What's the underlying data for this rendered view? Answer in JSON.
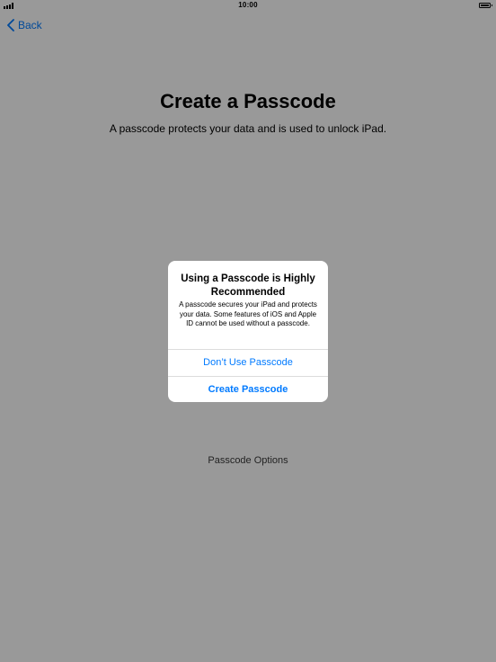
{
  "status_bar": {
    "time": "10:00"
  },
  "nav": {
    "back_label": "Back"
  },
  "page": {
    "title": "Create a Passcode",
    "subtitle": "A passcode protects your data and is used to unlock iPad.",
    "passcode_options_label": "Passcode Options"
  },
  "alert": {
    "title": "Using a Passcode is Highly Recommended",
    "message": "A passcode secures your iPad and protects your data. Some features of iOS and Apple ID cannot be used without a passcode.",
    "dont_use_label": "Don’t Use Passcode",
    "create_label": "Create Passcode"
  },
  "colors": {
    "accent": "#007aff",
    "overlay": "rgba(0,0,0,0.4)"
  },
  "icons": {
    "back": "chevron-left-icon",
    "signal": "cellular-signal-icon",
    "battery": "battery-icon"
  }
}
